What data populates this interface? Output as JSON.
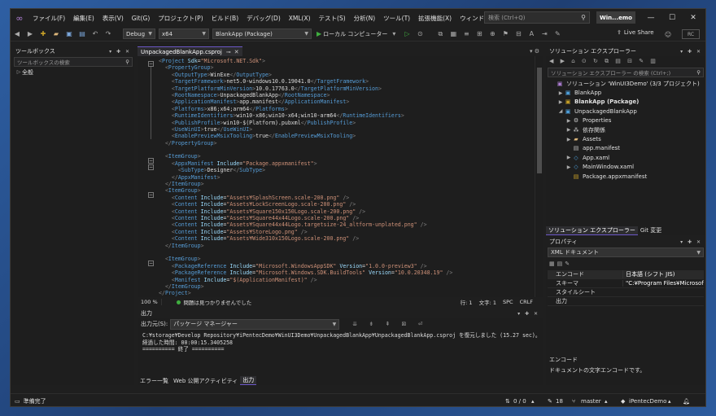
{
  "menu": [
    "ファイル(F)",
    "編集(E)",
    "表示(V)",
    "Git(G)",
    "プロジェクト(P)",
    "ビルド(B)",
    "デバッグ(D)",
    "XML(X)",
    "テスト(S)",
    "分析(N)",
    "ツール(T)",
    "拡張機能(X)",
    "ウィンドウ(W)",
    "ヘルプ(H)"
  ],
  "search": {
    "placeholder": "検索 (Ctrl+Q)"
  },
  "window_title": "Win...emo",
  "toolbar": {
    "config": "Debug",
    "platform": "x64",
    "startup": "BlankApp (Package)",
    "run_target": "ローカル コンピューター",
    "live_share": "Live Share",
    "rc": "RC"
  },
  "toolbox": {
    "title": "ツールボックス",
    "search_placeholder": "ツールボックスの検索",
    "group": "全般"
  },
  "editor": {
    "tab": "UnpackagedBlankApp.csproj",
    "zoom": "100 %",
    "issues": "問題は見つかりませんでした",
    "line": "行: 1",
    "col": "文字: 1",
    "spc": "SPC",
    "crlf": "CRLF",
    "lines": [
      [
        [
          "b",
          "<"
        ],
        [
          "k",
          "Project"
        ],
        [
          "a",
          " Sdk"
        ],
        [
          "t",
          "="
        ],
        [
          "v",
          "\"Microsoft.NET.Sdk\""
        ],
        [
          "b",
          ">"
        ]
      ],
      [
        [
          "b",
          "  <"
        ],
        [
          "k",
          "PropertyGroup"
        ],
        [
          "b",
          ">"
        ]
      ],
      [
        [
          "b",
          "    <"
        ],
        [
          "k",
          "OutputType"
        ],
        [
          "b",
          ">"
        ],
        [
          "t",
          "WinExe"
        ],
        [
          "b",
          "</"
        ],
        [
          "k",
          "OutputType"
        ],
        [
          "b",
          ">"
        ]
      ],
      [
        [
          "b",
          "    <"
        ],
        [
          "k",
          "TargetFramework"
        ],
        [
          "b",
          ">"
        ],
        [
          "t",
          "net5.0-windows10.0.19041.0"
        ],
        [
          "b",
          "</"
        ],
        [
          "k",
          "TargetFramework"
        ],
        [
          "b",
          ">"
        ]
      ],
      [
        [
          "b",
          "    <"
        ],
        [
          "k",
          "TargetPlatformMinVersion"
        ],
        [
          "b",
          ">"
        ],
        [
          "t",
          "10.0.17763.0"
        ],
        [
          "b",
          "</"
        ],
        [
          "k",
          "TargetPlatformMinVersion"
        ],
        [
          "b",
          ">"
        ]
      ],
      [
        [
          "b",
          "    <"
        ],
        [
          "k",
          "RootNamespace"
        ],
        [
          "b",
          ">"
        ],
        [
          "t",
          "UnpackagedBlankApp"
        ],
        [
          "b",
          "</"
        ],
        [
          "k",
          "RootNamespace"
        ],
        [
          "b",
          ">"
        ]
      ],
      [
        [
          "b",
          "    <"
        ],
        [
          "k",
          "ApplicationManifest"
        ],
        [
          "b",
          ">"
        ],
        [
          "t",
          "app.manifest"
        ],
        [
          "b",
          "</"
        ],
        [
          "k",
          "ApplicationManifest"
        ],
        [
          "b",
          ">"
        ]
      ],
      [
        [
          "b",
          "    <"
        ],
        [
          "k",
          "Platforms"
        ],
        [
          "b",
          ">"
        ],
        [
          "t",
          "x86;x64;arm64"
        ],
        [
          "b",
          "</"
        ],
        [
          "k",
          "Platforms"
        ],
        [
          "b",
          ">"
        ]
      ],
      [
        [
          "b",
          "    <"
        ],
        [
          "k",
          "RuntimeIdentifiers"
        ],
        [
          "b",
          ">"
        ],
        [
          "t",
          "win10-x86;win10-x64;win10-arm64"
        ],
        [
          "b",
          "</"
        ],
        [
          "k",
          "RuntimeIdentifiers"
        ],
        [
          "b",
          ">"
        ]
      ],
      [
        [
          "b",
          "    <"
        ],
        [
          "k",
          "PublishProfile"
        ],
        [
          "b",
          ">"
        ],
        [
          "t",
          "win10-$(Platform).pubxml"
        ],
        [
          "b",
          "</"
        ],
        [
          "k",
          "PublishProfile"
        ],
        [
          "b",
          ">"
        ]
      ],
      [
        [
          "b",
          "    <"
        ],
        [
          "k",
          "UseWinUI"
        ],
        [
          "b",
          ">"
        ],
        [
          "t",
          "true"
        ],
        [
          "b",
          "</"
        ],
        [
          "k",
          "UseWinUI"
        ],
        [
          "b",
          ">"
        ]
      ],
      [
        [
          "b",
          "    <"
        ],
        [
          "k",
          "EnablePreviewMsixTooling"
        ],
        [
          "b",
          ">"
        ],
        [
          "t",
          "true"
        ],
        [
          "b",
          "</"
        ],
        [
          "k",
          "EnablePreviewMsixTooling"
        ],
        [
          "b",
          ">"
        ]
      ],
      [
        [
          "b",
          "  </"
        ],
        [
          "k",
          "PropertyGroup"
        ],
        [
          "b",
          ">"
        ]
      ],
      [
        [
          "t",
          ""
        ]
      ],
      [
        [
          "b",
          "  <"
        ],
        [
          "k",
          "ItemGroup"
        ],
        [
          "b",
          ">"
        ]
      ],
      [
        [
          "b",
          "    <"
        ],
        [
          "k",
          "AppxManifest"
        ],
        [
          "a",
          " Include"
        ],
        [
          "t",
          "="
        ],
        [
          "v",
          "\"Package.appxmanifest\""
        ],
        [
          "b",
          ">"
        ]
      ],
      [
        [
          "b",
          "      <"
        ],
        [
          "k",
          "SubType"
        ],
        [
          "b",
          ">"
        ],
        [
          "t",
          "Designer"
        ],
        [
          "b",
          "</"
        ],
        [
          "k",
          "SubType"
        ],
        [
          "b",
          ">"
        ]
      ],
      [
        [
          "b",
          "    </"
        ],
        [
          "k",
          "AppxManifest"
        ],
        [
          "b",
          ">"
        ]
      ],
      [
        [
          "b",
          "  </"
        ],
        [
          "k",
          "ItemGroup"
        ],
        [
          "b",
          ">"
        ]
      ],
      [
        [
          "b",
          "  <"
        ],
        [
          "k",
          "ItemGroup"
        ],
        [
          "b",
          ">"
        ]
      ],
      [
        [
          "b",
          "    <"
        ],
        [
          "k",
          "Content"
        ],
        [
          "a",
          " Include"
        ],
        [
          "t",
          "="
        ],
        [
          "v",
          "\"Assets¥SplashScreen.scale-200.png\""
        ],
        [
          "b",
          " />"
        ]
      ],
      [
        [
          "b",
          "    <"
        ],
        [
          "k",
          "Content"
        ],
        [
          "a",
          " Include"
        ],
        [
          "t",
          "="
        ],
        [
          "v",
          "\"Assets¥LockScreenLogo.scale-200.png\""
        ],
        [
          "b",
          " />"
        ]
      ],
      [
        [
          "b",
          "    <"
        ],
        [
          "k",
          "Content"
        ],
        [
          "a",
          " Include"
        ],
        [
          "t",
          "="
        ],
        [
          "v",
          "\"Assets¥Square150x150Logo.scale-200.png\""
        ],
        [
          "b",
          " />"
        ]
      ],
      [
        [
          "b",
          "    <"
        ],
        [
          "k",
          "Content"
        ],
        [
          "a",
          " Include"
        ],
        [
          "t",
          "="
        ],
        [
          "v",
          "\"Assets¥Square44x44Logo.scale-200.png\""
        ],
        [
          "b",
          " />"
        ]
      ],
      [
        [
          "b",
          "    <"
        ],
        [
          "k",
          "Content"
        ],
        [
          "a",
          " Include"
        ],
        [
          "t",
          "="
        ],
        [
          "v",
          "\"Assets¥Square44x44Logo.targetsize-24_altform-unplated.png\""
        ],
        [
          "b",
          " />"
        ]
      ],
      [
        [
          "b",
          "    <"
        ],
        [
          "k",
          "Content"
        ],
        [
          "a",
          " Include"
        ],
        [
          "t",
          "="
        ],
        [
          "v",
          "\"Assets¥StoreLogo.png\""
        ],
        [
          "b",
          " />"
        ]
      ],
      [
        [
          "b",
          "    <"
        ],
        [
          "k",
          "Content"
        ],
        [
          "a",
          " Include"
        ],
        [
          "t",
          "="
        ],
        [
          "v",
          "\"Assets¥Wide310x150Logo.scale-200.png\""
        ],
        [
          "b",
          " />"
        ]
      ],
      [
        [
          "b",
          "  </"
        ],
        [
          "k",
          "ItemGroup"
        ],
        [
          "b",
          ">"
        ]
      ],
      [
        [
          "t",
          ""
        ]
      ],
      [
        [
          "b",
          "  <"
        ],
        [
          "k",
          "ItemGroup"
        ],
        [
          "b",
          ">"
        ]
      ],
      [
        [
          "b",
          "    <"
        ],
        [
          "k",
          "PackageReference"
        ],
        [
          "a",
          " Include"
        ],
        [
          "t",
          "="
        ],
        [
          "v",
          "\"Microsoft.WindowsAppSDK\""
        ],
        [
          "a",
          " Version"
        ],
        [
          "t",
          "="
        ],
        [
          "v",
          "\"1.0.0-preview3\""
        ],
        [
          "b",
          " />"
        ]
      ],
      [
        [
          "b",
          "    <"
        ],
        [
          "k",
          "PackageReference"
        ],
        [
          "a",
          " Include"
        ],
        [
          "t",
          "="
        ],
        [
          "v",
          "\"Microsoft.Windows.SDK.BuildTools\""
        ],
        [
          "a",
          " Version"
        ],
        [
          "t",
          "="
        ],
        [
          "v",
          "\"10.0.20348.19\""
        ],
        [
          "b",
          " />"
        ]
      ],
      [
        [
          "b",
          "    <"
        ],
        [
          "k",
          "Manifest"
        ],
        [
          "a",
          " Include"
        ],
        [
          "t",
          "="
        ],
        [
          "v",
          "\"$(ApplicationManifest)\""
        ],
        [
          "b",
          " />"
        ]
      ],
      [
        [
          "b",
          "  </"
        ],
        [
          "k",
          "ItemGroup"
        ],
        [
          "b",
          ">"
        ]
      ],
      [
        [
          "b",
          "</"
        ],
        [
          "k",
          "Project"
        ],
        [
          "b",
          ">"
        ]
      ]
    ]
  },
  "output": {
    "title": "出力",
    "source_label": "出力元(S):",
    "source": "パッケージ マネージャー",
    "lines": [
      "C:¥storage¥Develop Repository¥iPentecDemo¥WinUI3Demo¥UnpackagedBlankApp¥UnpackagedBlankApp.csproj を復元しました (15.27 sec)。",
      "経過した時間: 00:00:15.3405258",
      "========== 終了 =========="
    ],
    "tabs": [
      "エラー一覧",
      "Web 公開アクティビティ",
      "出力"
    ]
  },
  "solution": {
    "title": "ソリューション エクスプローラー",
    "search_placeholder": "ソリューション エクスプローラー の検索 (Ctrl+;)",
    "items": [
      {
        "label": "ソリューション 'WinUI3Demo' (3/3 プロジェクト)",
        "indent": 0,
        "icon": "solution-icon",
        "tw": ""
      },
      {
        "label": "BlankApp",
        "indent": 1,
        "icon": "project-icon",
        "tw": "▶"
      },
      {
        "label": "BlankApp (Package)",
        "indent": 1,
        "icon": "package-project-icon",
        "tw": "▶",
        "bold": true
      },
      {
        "label": "UnpackagedBlankApp",
        "indent": 1,
        "icon": "project-icon",
        "tw": "◢"
      },
      {
        "label": "Properties",
        "indent": 2,
        "icon": "properties-icon",
        "tw": "▶"
      },
      {
        "label": "依存関係",
        "indent": 2,
        "icon": "dependencies-icon",
        "tw": "▶"
      },
      {
        "label": "Assets",
        "indent": 2,
        "icon": "folder-icon",
        "tw": "▶"
      },
      {
        "label": "app.manifest",
        "indent": 2,
        "icon": "manifest-file-icon",
        "tw": ""
      },
      {
        "label": "App.xaml",
        "indent": 2,
        "icon": "xaml-file-icon",
        "tw": "▶"
      },
      {
        "label": "MainWindow.xaml",
        "indent": 2,
        "icon": "xaml-file-icon",
        "tw": "▶"
      },
      {
        "label": "Package.appxmanifest",
        "indent": 2,
        "icon": "appxmanifest-file-icon",
        "tw": ""
      }
    ],
    "tabs": [
      "ソリューション エクスプローラー",
      "Git 変更"
    ]
  },
  "properties": {
    "title": "プロパティ",
    "object": "XML ドキュメント",
    "rows": [
      {
        "k": "エンコード",
        "v": "日本語 (シフト JIS)",
        "sel": true
      },
      {
        "k": "スキーマ",
        "v": "\"C:¥Program Files¥Microsoft V"
      },
      {
        "k": "スタイルシート",
        "v": ""
      },
      {
        "k": "出力",
        "v": ""
      }
    ],
    "desc_title": "エンコード",
    "desc_text": "ドキュメントの文字エンコードです。"
  },
  "status": {
    "ready": "準備完了",
    "updown": "0 / 0",
    "pencil_count": "18",
    "branch": "master",
    "repo": "iPentecDemo"
  },
  "colors": {
    "accent": "#6b57c7",
    "keyword": "#569cd6",
    "attr": "#9cdcfe",
    "value": "#ce9178"
  }
}
